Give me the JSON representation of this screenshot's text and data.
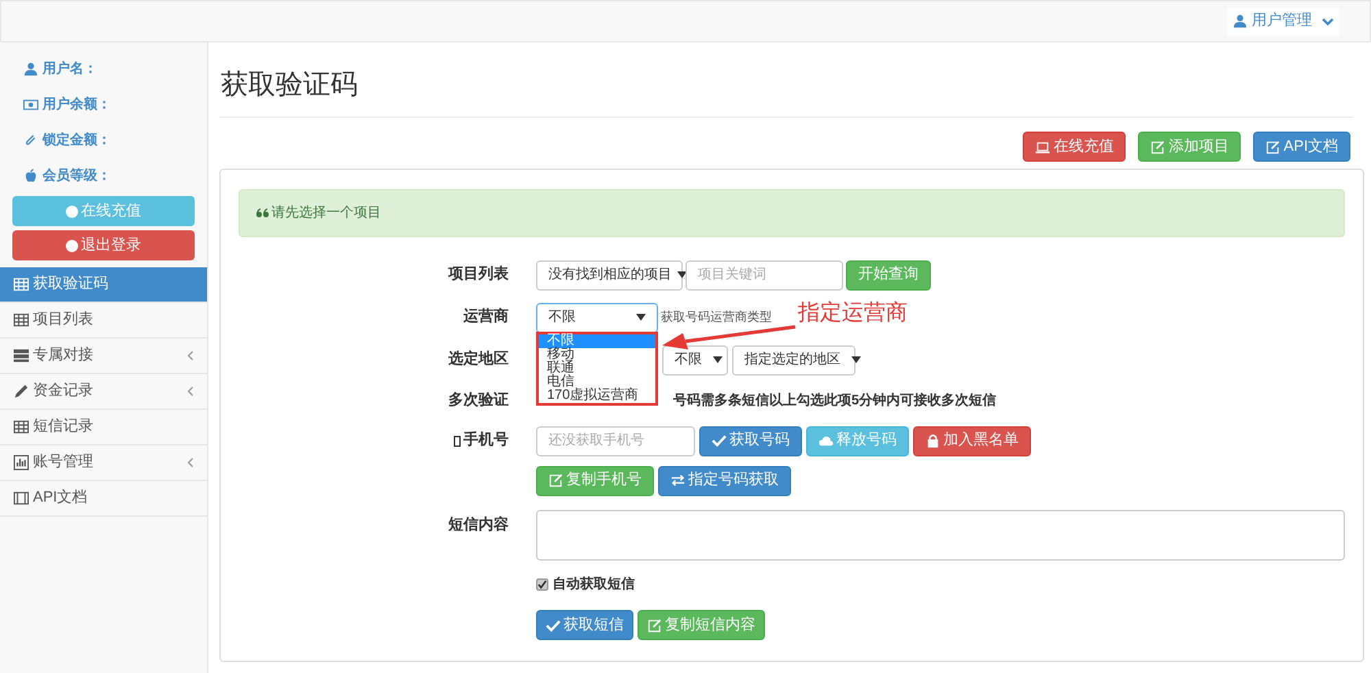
{
  "top_bar": {
    "user_menu": "用户管理"
  },
  "sidebar": {
    "info": [
      {
        "kind": "user",
        "label": "用户名："
      },
      {
        "kind": "money",
        "label": "用户余额："
      },
      {
        "kind": "clip",
        "label": "锁定金额："
      },
      {
        "kind": "apple",
        "label": "会员等级："
      }
    ],
    "buttons": [
      {
        "kind": "recharge",
        "label": "在线充值"
      },
      {
        "kind": "logout",
        "label": "退出登录"
      }
    ],
    "items": [
      {
        "label": "获取验证码",
        "kind": "table",
        "selected": true,
        "has_submenu": false
      },
      {
        "label": "项目列表",
        "kind": "table",
        "selected": false,
        "has_submenu": false
      },
      {
        "label": "专属对接",
        "kind": "server",
        "selected": false,
        "has_submenu": true
      },
      {
        "label": "资金记录",
        "kind": "pencil",
        "selected": false,
        "has_submenu": true
      },
      {
        "label": "短信记录",
        "kind": "table",
        "selected": false,
        "has_submenu": false
      },
      {
        "label": "账号管理",
        "kind": "chart",
        "selected": false,
        "has_submenu": true
      },
      {
        "label": "API文档",
        "kind": "film",
        "selected": false,
        "has_submenu": false
      }
    ]
  },
  "page": {
    "title": "获取验证码",
    "actions": [
      {
        "kind": "danger",
        "label": "在线充值"
      },
      {
        "kind": "success",
        "label": "添加项目"
      },
      {
        "kind": "primary",
        "label": "API文档"
      }
    ],
    "alert": "请先选择一个项目",
    "project": {
      "label": "项目列表",
      "select": "没有找到相应的项目",
      "placeholder": "项目关键词",
      "button": "开始查询"
    },
    "operator": {
      "label": "运营商",
      "select": "不限",
      "hint": "获取号码运营商类型",
      "options": [
        {
          "label": "不限",
          "selected": true
        },
        {
          "label": "移动",
          "selected": false
        },
        {
          "label": "联通",
          "selected": false
        },
        {
          "label": "电信",
          "selected": false
        },
        {
          "label": "170虚拟运营商",
          "selected": false
        }
      ]
    },
    "region": {
      "label": "选定地区",
      "selects": [
        "不限",
        "指定选定的地区"
      ]
    },
    "multi": {
      "label": "多次验证",
      "text": "号码需多条短信以上勾选此项5分钟内可接收多次短信"
    },
    "phone": {
      "label": "手机号",
      "placeholder": "还没获取手机号",
      "buttons": [
        {
          "kind": "primary",
          "label": "获取号码"
        },
        {
          "kind": "info",
          "label": "释放号码"
        },
        {
          "kind": "danger",
          "label": "加入黑名单"
        }
      ],
      "buttons2": [
        {
          "kind": "success",
          "label": "复制手机号"
        },
        {
          "kind": "primary",
          "label": "指定号码获取"
        }
      ]
    },
    "sms": {
      "label": "短信内容",
      "auto": {
        "label": "自动获取短信",
        "checked": true
      },
      "buttons": [
        {
          "kind": "primary",
          "label": "获取短信"
        },
        {
          "kind": "success",
          "label": "复制短信内容"
        }
      ]
    },
    "annotation": "指定运营商"
  }
}
